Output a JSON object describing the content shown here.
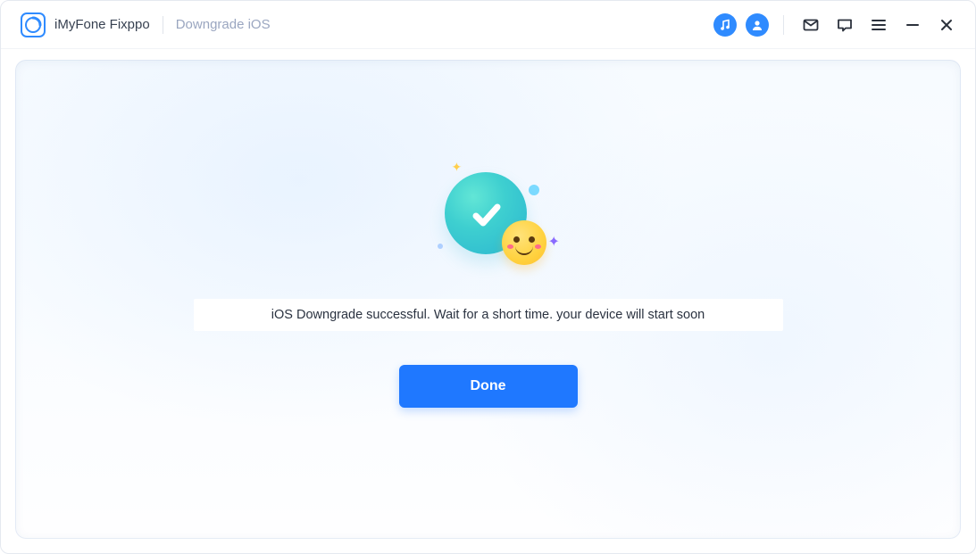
{
  "header": {
    "app_title": "iMyFone Fixppo",
    "subtitle": "Downgrade iOS"
  },
  "main": {
    "status_message": "iOS Downgrade successful. Wait for a short time. your device will start soon",
    "done_label": "Done"
  },
  "colors": {
    "primary": "#1f78ff",
    "accentTeal": "#3ecfd0"
  }
}
